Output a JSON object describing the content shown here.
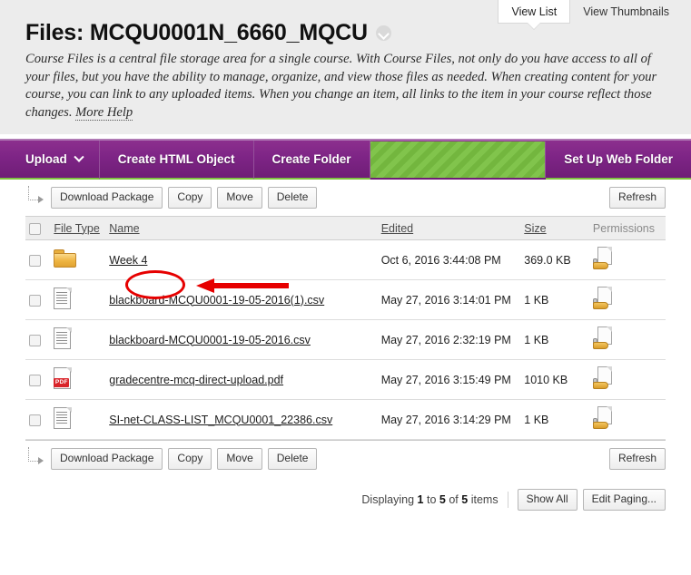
{
  "view_tabs": [
    {
      "label": "View List",
      "active": true
    },
    {
      "label": "View Thumbnails",
      "active": false
    }
  ],
  "header": {
    "title": "Files: MCQU0001N_6660_MQCU",
    "chevron_icon": "chevron-down-circle-icon",
    "description": "Course Files is a central file storage area for a single course. With Course Files, not only do you have access to all of your files, but you have the ability to manage, organize, and view those files as needed. When creating content for your course, you can link to any uploaded items. When you change an item, all links to the item in your course reflect those changes.",
    "more_help": "More Help"
  },
  "action_bar": {
    "upload": "Upload",
    "create_html_object": "Create HTML Object",
    "create_folder": "Create Folder",
    "set_up_web_folder": "Set Up Web Folder",
    "accent_purple": "#7d2485",
    "accent_green": "#7ac142"
  },
  "toolbar": {
    "download_package": "Download Package",
    "copy": "Copy",
    "move": "Move",
    "delete": "Delete",
    "refresh": "Refresh"
  },
  "table": {
    "columns": {
      "file_type": "File Type",
      "name": "Name",
      "edited": "Edited",
      "size": "Size",
      "permissions": "Permissions"
    },
    "rows": [
      {
        "icon": "folder-icon",
        "name": "Week 4",
        "edited": "Oct 6, 2016 3:44:08 PM",
        "size": "369.0 KB",
        "permissions_icon": "document-permissions-icon"
      },
      {
        "icon": "csv-document-icon",
        "name": "blackboard-MCQU0001-19-05-2016(1).csv",
        "edited": "May 27, 2016 3:14:01 PM",
        "size": "1 KB",
        "permissions_icon": "document-permissions-icon"
      },
      {
        "icon": "csv-document-icon",
        "name": "blackboard-MCQU0001-19-05-2016.csv",
        "edited": "May 27, 2016 2:32:19 PM",
        "size": "1 KB",
        "permissions_icon": "document-permissions-icon"
      },
      {
        "icon": "pdf-document-icon",
        "name": "gradecentre-mcq-direct-upload.pdf",
        "edited": "May 27, 2016 3:15:49 PM",
        "size": "1010 KB",
        "permissions_icon": "document-permissions-icon"
      },
      {
        "icon": "csv-document-icon",
        "name": "SI-net-CLASS-LIST_MCQU0001_22386.csv",
        "edited": "May 27, 2016 3:14:29 PM",
        "size": "1 KB",
        "permissions_icon": "document-permissions-icon"
      }
    ]
  },
  "pagination": {
    "displaying_prefix": "Displaying",
    "from": "1",
    "to_word": "to",
    "to": "5",
    "of_word": "of",
    "total": "5",
    "items_word": "items",
    "show_all": "Show All",
    "edit_paging": "Edit Paging..."
  },
  "annotations": {
    "color": "#e60000",
    "circle_target": "Week 4",
    "arrow_direction": "left"
  }
}
